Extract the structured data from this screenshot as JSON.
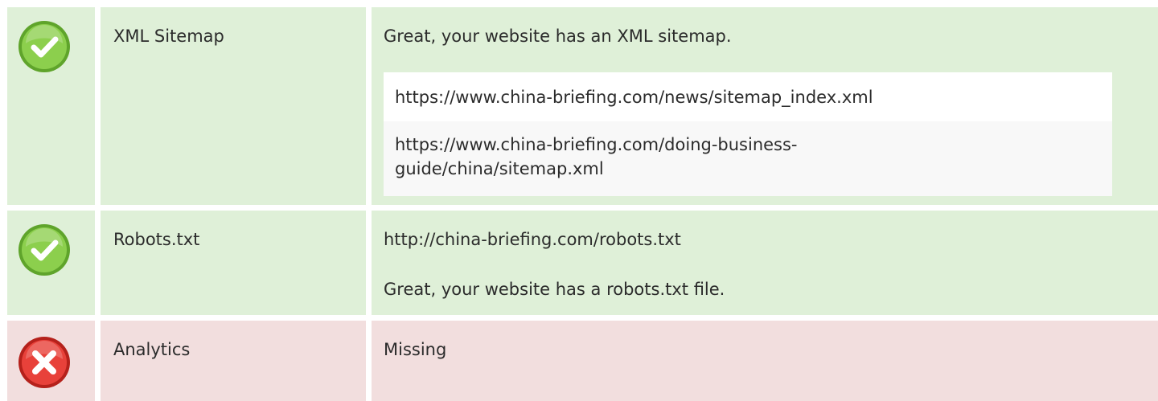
{
  "rows": [
    {
      "status": "pass",
      "icon": "check-circle-icon",
      "name": "XML Sitemap",
      "message": "Great, your website has an XML sitemap.",
      "urls": [
        "https://www.china-briefing.com/news/sitemap_index.xml",
        "https://www.china-briefing.com/doing-business-\nguide/china/sitemap.xml"
      ]
    },
    {
      "status": "pass",
      "icon": "check-circle-icon",
      "name": "Robots.txt",
      "url": "http://china-briefing.com/robots.txt",
      "message": "Great, your website has a robots.txt file."
    },
    {
      "status": "fail",
      "icon": "x-circle-icon",
      "name": "Analytics",
      "message": "Missing"
    }
  ],
  "colors": {
    "pass_bg": "#dff0d8",
    "fail_bg": "#f2dede",
    "pass_icon": "#7cc241",
    "fail_icon": "#e0322a"
  }
}
